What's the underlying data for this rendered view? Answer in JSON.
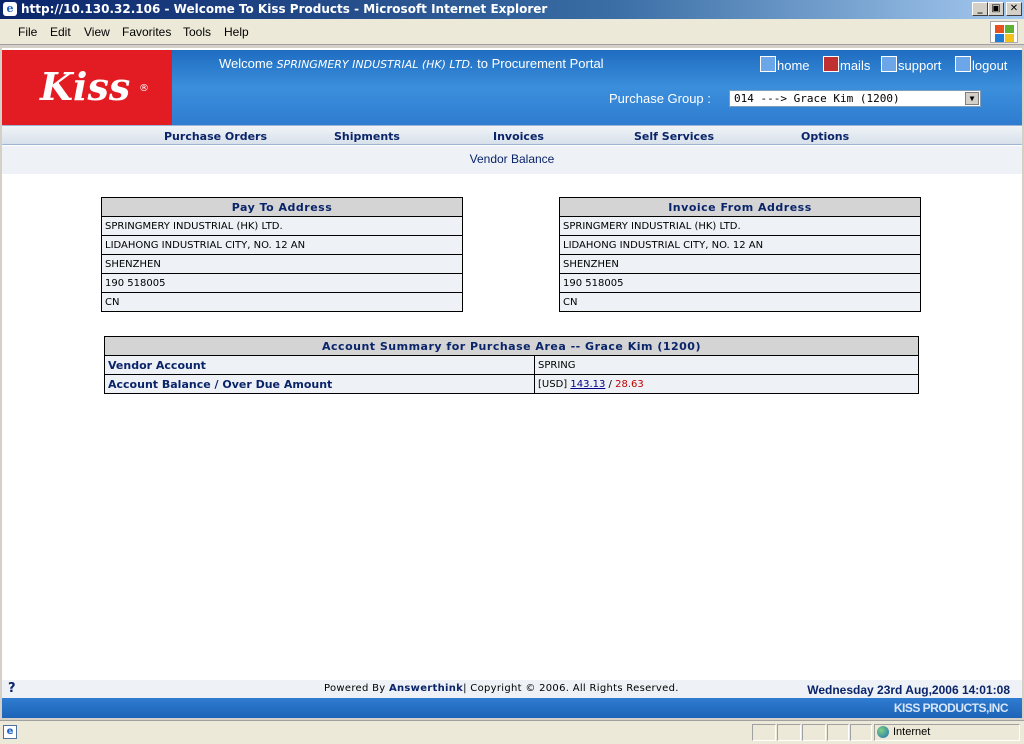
{
  "window": {
    "title": "http://10.130.32.106 - Welcome To Kiss Products - Microsoft Internet Explorer",
    "minimize": "_",
    "maximize": "▣",
    "close": "✕"
  },
  "menu": {
    "file": "File",
    "edit": "Edit",
    "view": "View",
    "favorites": "Favorites",
    "tools": "Tools",
    "help": "Help"
  },
  "header": {
    "logo": "Kiss",
    "logo_reg": "®",
    "welcome_prefix": "Welcome",
    "company": "SPRINGMERY INDUSTRIAL (HK) LTD.",
    "welcome_suffix": "to Procurement Portal",
    "links": {
      "home": "home",
      "mails": "mails",
      "support": "support",
      "logout": "logout"
    },
    "purchase_group_label": "Purchase Group :",
    "purchase_group_value": "014 ---> Grace Kim (1200)"
  },
  "nav": {
    "purchase_orders": "Purchase Orders",
    "shipments": "Shipments",
    "invoices": "Invoices",
    "self_services": "Self Services",
    "options": "Options"
  },
  "page_title": "Vendor Balance",
  "pay_to": {
    "heading": "Pay To Address",
    "lines": [
      "SPRINGMERY INDUSTRIAL (HK) LTD.",
      "LIDAHONG INDUSTRIAL CITY, NO. 12 AN",
      "SHENZHEN",
      "190 518005",
      "CN"
    ]
  },
  "invoice_from": {
    "heading": "Invoice From Address",
    "lines": [
      "SPRINGMERY INDUSTRIAL (HK) LTD.",
      "LIDAHONG INDUSTRIAL CITY, NO. 12 AN",
      "SHENZHEN",
      "190 518005",
      "CN"
    ]
  },
  "summary": {
    "heading": "Account Summary for Purchase Area --  Grace Kim (1200)",
    "vendor_account_label": "Vendor Account",
    "vendor_account_value": "SPRING",
    "balance_label": "Account Balance / Over Due Amount",
    "currency": "[USD]",
    "balance": "143.13",
    "separator": "/",
    "overdue": "28.63"
  },
  "footer": {
    "help": "?",
    "powered_prefix": "Powered By",
    "powered_by": "Answerthink",
    "copyright": "| Copyright © 2006. All Rights Reserved.",
    "datetime": "Wednesday 23rd Aug,2006 14:01:08",
    "brand": "KISS PRODUCTS,INC"
  },
  "status": {
    "zone": "Internet"
  }
}
